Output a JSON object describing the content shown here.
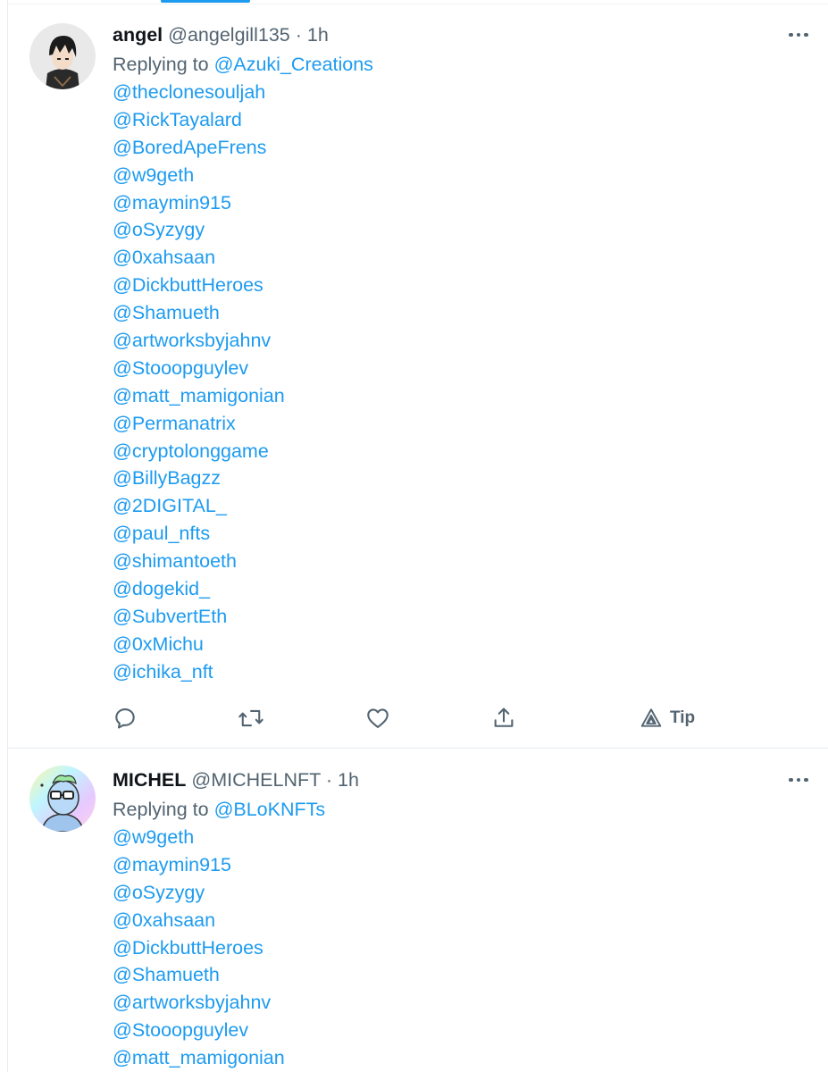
{
  "tweets": [
    {
      "display_name": "angel",
      "handle": "@angelgill135",
      "separator": "·",
      "time": "1h",
      "replying_prefix": "Replying to",
      "replying_to": "@Azuki_Creations",
      "mentions": [
        "@theclonesouljah",
        "@RickTayalard",
        "@BoredApeFrens",
        "@w9geth",
        "@maymin915",
        "@oSyzygy",
        "@0xahsaan",
        "@DickbuttHeroes",
        "@Shamueth",
        "@artworksbyjahnv",
        "@Stooopguylev",
        "@matt_mamigonian",
        "@Permanatrix",
        "@cryptolonggame",
        "@BillyBagzz",
        "@2DIGITAL_",
        "@paul_nfts",
        "@shimantoeth",
        "@dogekid_",
        "@SubvertEth",
        "@0xMichu",
        "@ichika_nft"
      ],
      "actions": {
        "reply_icon": "reply-icon",
        "retweet_icon": "retweet-icon",
        "like_icon": "heart-icon",
        "share_icon": "share-icon",
        "tip_icon": "tip-icon",
        "tip_label": "Tip"
      }
    },
    {
      "display_name": "MICHEL",
      "handle": "@MICHELNFT",
      "separator": "·",
      "time": "1h",
      "replying_prefix": "Replying to",
      "replying_to": "@BLoKNFTs",
      "mentions": [
        "@w9geth",
        "@maymin915",
        "@oSyzygy",
        "@0xahsaan",
        "@DickbuttHeroes",
        "@Shamueth",
        "@artworksbyjahnv",
        "@Stooopguylev",
        "@matt_mamigonian"
      ]
    }
  ],
  "colors": {
    "link": "#1d9bf0",
    "secondary_text": "#536471",
    "primary_text": "#0f1419",
    "divider": "#e6ecf0"
  },
  "icons": {
    "more": "more-dots-icon"
  }
}
